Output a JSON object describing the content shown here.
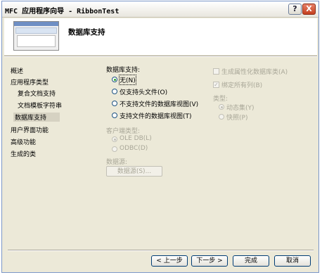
{
  "window": {
    "title": "MFC 应用程序向导 - RibbonTest",
    "help_glyph": "?",
    "close_glyph": "X"
  },
  "header": {
    "title": "数据库支持"
  },
  "nav": {
    "items": [
      {
        "label": "概述",
        "level": 0,
        "selected": false
      },
      {
        "label": "应用程序类型",
        "level": 0,
        "selected": false
      },
      {
        "label": "复合文档支持",
        "level": 1,
        "selected": false
      },
      {
        "label": "文档模板字符串",
        "level": 1,
        "selected": false
      },
      {
        "label": "数据库支持",
        "level": 0,
        "selected": true
      },
      {
        "label": "用户界面功能",
        "level": 0,
        "selected": false
      },
      {
        "label": "高级功能",
        "level": 0,
        "selected": false
      },
      {
        "label": "生成的类",
        "level": 0,
        "selected": false
      }
    ]
  },
  "db_support": {
    "label": "数据库支持:",
    "options": [
      {
        "label": "无(N)",
        "selected": true
      },
      {
        "label": "仅支持头文件(O)",
        "selected": false
      },
      {
        "label": "不支持文件的数据库视图(V)",
        "selected": false
      },
      {
        "label": "支持文件的数据库视图(T)",
        "selected": false
      }
    ]
  },
  "client_type": {
    "label": "客户端类型:",
    "options": [
      {
        "label": "OLE DB(L)",
        "selected": true
      },
      {
        "label": "ODBC(D)",
        "selected": false
      }
    ]
  },
  "data_source": {
    "label": "数据源:",
    "button": "数据源(S)..."
  },
  "attributed_db_class": {
    "label": "生成属性化数据库类(A)",
    "checked": false
  },
  "bind_all_columns": {
    "label": "绑定所有列(B)",
    "checked": true
  },
  "recordset_type": {
    "label": "类型:",
    "options": [
      {
        "label": "动态集(Y)",
        "selected": true
      },
      {
        "label": "快照(P)",
        "selected": false
      }
    ]
  },
  "buttons": {
    "back": "< 上一步",
    "next": "下一步 >",
    "finish": "完成",
    "cancel": "取消"
  }
}
